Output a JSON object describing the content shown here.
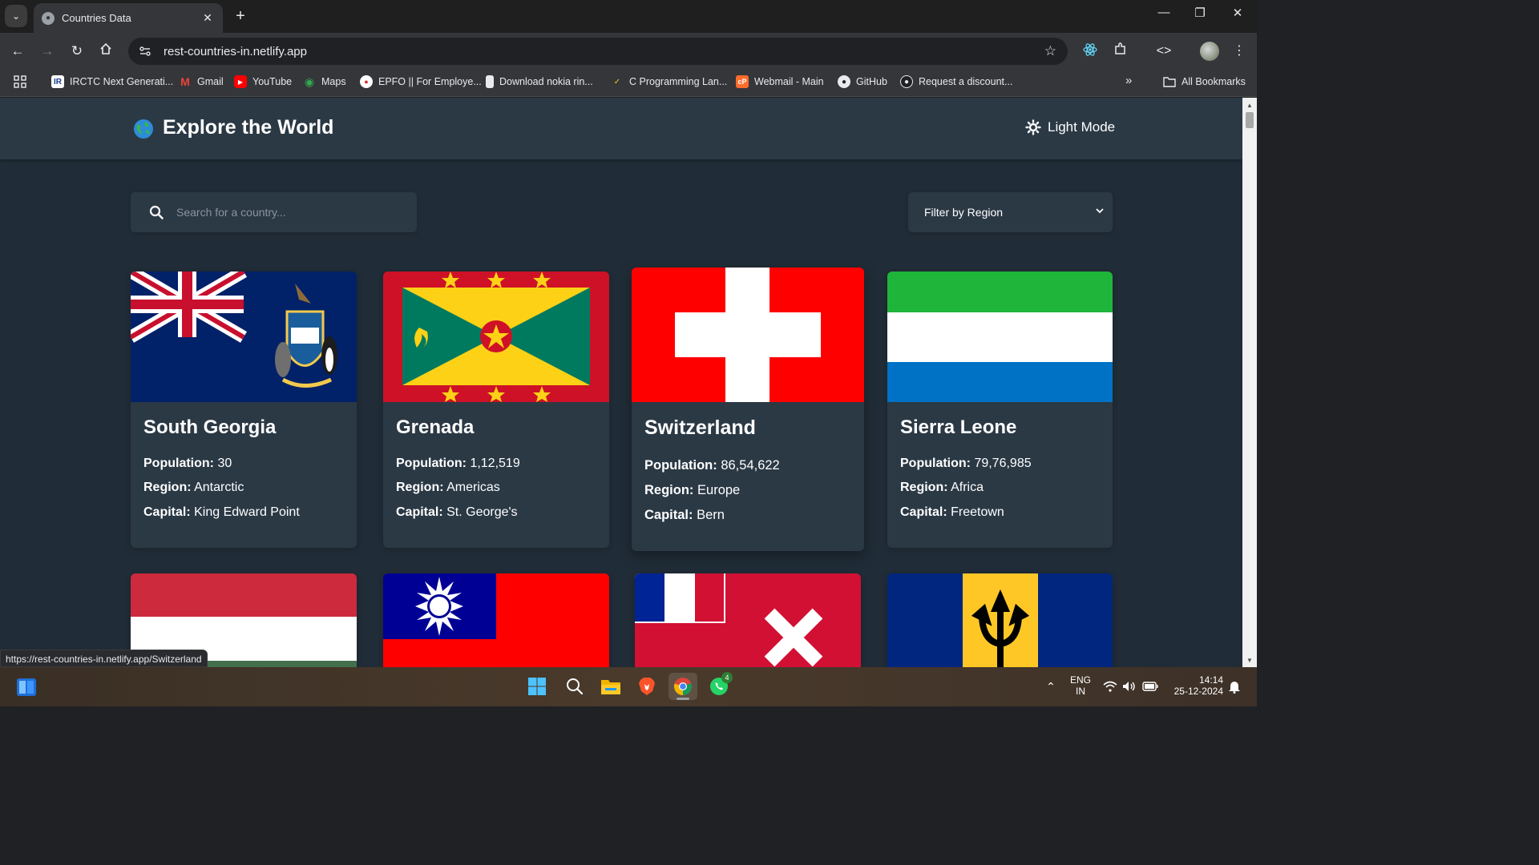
{
  "browser": {
    "tab": {
      "title": "Countries Data"
    },
    "address": {
      "url": "rest-countries-in.netlify.app"
    },
    "bookmarks": [
      {
        "label": "IRCTC Next Generati...",
        "icon": "irctc-icon"
      },
      {
        "label": "Gmail",
        "icon": "gmail-icon"
      },
      {
        "label": "YouTube",
        "icon": "youtube-icon"
      },
      {
        "label": "Maps",
        "icon": "maps-icon"
      },
      {
        "label": "EPFO || For Employe...",
        "icon": "epfo-icon"
      },
      {
        "label": "Download nokia rin...",
        "icon": "download-icon"
      },
      {
        "label": "C Programming Lan...",
        "icon": "c-programming-icon"
      },
      {
        "label": "Webmail - Main",
        "icon": "webmail-icon"
      },
      {
        "label": "GitHub",
        "icon": "github-icon"
      },
      {
        "label": "Request a discount...",
        "icon": "github-icon"
      }
    ],
    "all_bookmarks_label": "All Bookmarks",
    "status_url": "https://rest-countries-in.netlify.app/Switzerland"
  },
  "app": {
    "title": "Explore the World",
    "mode_toggle_label": "Light Mode",
    "search": {
      "placeholder": "Search for a country...",
      "value": ""
    },
    "filter": {
      "label": "Filter by Region"
    },
    "labels": {
      "population": "Population:",
      "region": "Region:",
      "capital": "Capital:"
    },
    "countries": [
      {
        "name": "South Georgia",
        "population": "30",
        "region": "Antarctic",
        "capital": "King Edward Point"
      },
      {
        "name": "Grenada",
        "population": "1,12,519",
        "region": "Americas",
        "capital": "St. George's"
      },
      {
        "name": "Switzerland",
        "population": "86,54,622",
        "region": "Europe",
        "capital": "Bern"
      },
      {
        "name": "Sierra Leone",
        "population": "79,76,985",
        "region": "Africa",
        "capital": "Freetown"
      }
    ],
    "colors": {
      "background": "#202c37",
      "element": "#2b3945",
      "text": "#ffffff"
    }
  },
  "taskbar": {
    "language": "ENG",
    "region": "IN",
    "time": "14:14",
    "date": "25-12-2024",
    "whatsapp_badge": "4"
  }
}
